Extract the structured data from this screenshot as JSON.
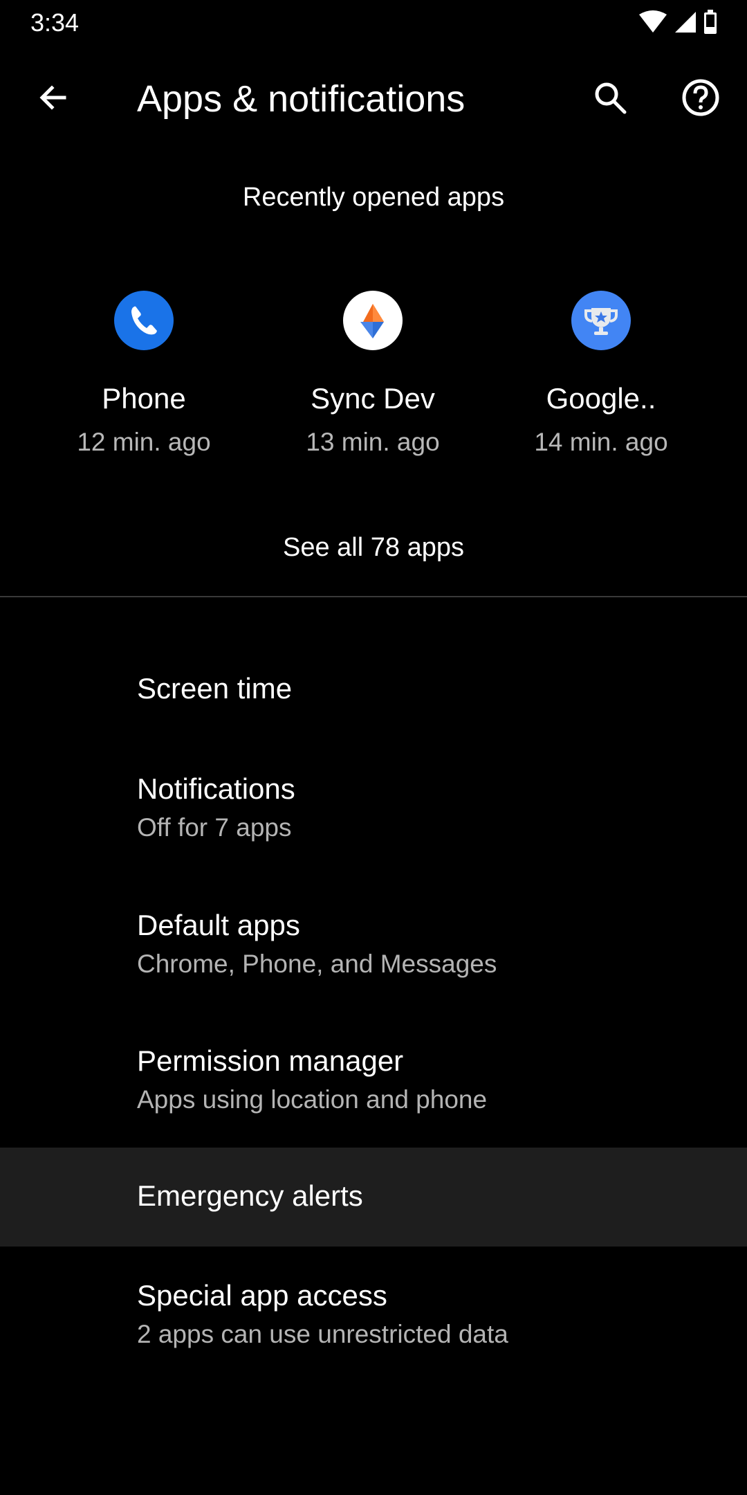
{
  "status_bar": {
    "time": "3:34",
    "icons": [
      "wifi-icon",
      "cell-signal-icon",
      "battery-icon"
    ]
  },
  "top_bar": {
    "title": "Apps & notifications",
    "back_icon": "arrow-left",
    "actions": [
      "search-icon",
      "help-icon"
    ]
  },
  "recent_apps": {
    "header": "Recently opened apps",
    "apps": [
      {
        "name": "Phone",
        "time": "12 min. ago",
        "icon": "phone-icon",
        "color": "#1a73e8"
      },
      {
        "name": "Sync Dev",
        "time": "13 min. ago",
        "icon": "sync-dev-icon",
        "color": "#ffffff"
      },
      {
        "name": "Google..",
        "time": "14 min. ago",
        "icon": "trophy-icon",
        "color": "#4285f4"
      }
    ],
    "see_all": "See all 78 apps"
  },
  "menu": [
    {
      "title": "Screen time",
      "subtitle": ""
    },
    {
      "title": "Notifications",
      "subtitle": "Off for 7 apps"
    },
    {
      "title": "Default apps",
      "subtitle": "Chrome, Phone, and Messages"
    },
    {
      "title": "Permission manager",
      "subtitle": "Apps using location and phone"
    },
    {
      "title": "Emergency alerts",
      "subtitle": "",
      "highlighted": true
    },
    {
      "title": "Special app access",
      "subtitle": "2 apps can use unrestricted data"
    }
  ],
  "colors": {
    "background": "#000000",
    "highlight": "#1e1e1e",
    "secondary_text": "#b4b4b4",
    "divider": "#3a3a3a"
  }
}
